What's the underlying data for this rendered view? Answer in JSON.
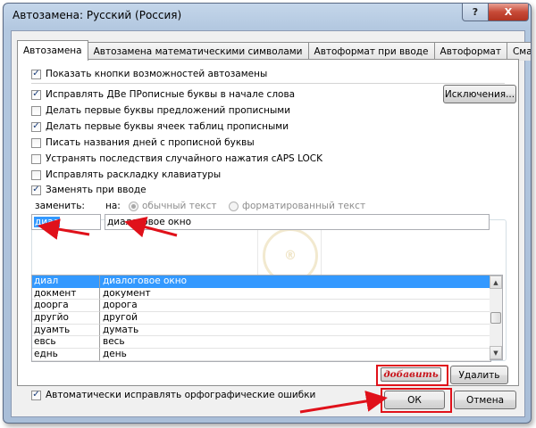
{
  "window": {
    "title": "Автозамена: Русский (Россия)",
    "help_glyph": "?",
    "close_glyph": "X"
  },
  "tabs": [
    {
      "label": "Автозамена",
      "active": true
    },
    {
      "label": "Автозамена математическими символами",
      "active": false
    },
    {
      "label": "Автоформат при вводе",
      "active": false
    },
    {
      "label": "Автоформат",
      "active": false
    },
    {
      "label": "Смарт-теги",
      "active": false
    }
  ],
  "options": {
    "show_buttons": {
      "label": "Показать кнопки возможностей автозамены",
      "checked": true
    },
    "two_caps": {
      "label": "Исправлять ДВе ПРописные буквы в начале слова",
      "checked": true
    },
    "first_sentence": {
      "label": "Делать первые буквы предложений прописными",
      "checked": false
    },
    "first_cell": {
      "label": "Делать первые буквы ячеек таблиц прописными",
      "checked": true
    },
    "day_names": {
      "label": "Писать названия дней с прописной буквы",
      "checked": false
    },
    "caps_lock": {
      "label": "Устранять последствия случайного нажатия cAPS LOCK",
      "checked": false
    },
    "keyboard_layout": {
      "label": "Исправлять раскладку клавиатуры",
      "checked": false
    },
    "replace_as_type": {
      "label": "Заменять при вводе",
      "checked": true
    },
    "auto_spelling": {
      "label": "Автоматически исправлять орфографические ошибки",
      "checked": true
    }
  },
  "buttons": {
    "exceptions": "Исключения...",
    "add": "добавить",
    "delete": "Удалить",
    "ok": "ОК",
    "cancel": "Отмена"
  },
  "replace": {
    "replace_label": "заменить:",
    "with_label": "на:",
    "plain_text": "обычный текст",
    "formatted_text": "форматированный текст",
    "replace_value": "диал",
    "with_value": "диалоговое окно"
  },
  "entries": [
    {
      "from": "диал",
      "to": "диалоговое окно",
      "selected": true
    },
    {
      "from": "докмент",
      "to": "документ",
      "selected": false
    },
    {
      "from": "доорга",
      "to": "дорога",
      "selected": false
    },
    {
      "from": "другйо",
      "to": "другой",
      "selected": false
    },
    {
      "from": "дуамть",
      "to": "думать",
      "selected": false
    },
    {
      "from": "евсь",
      "to": "весь",
      "selected": false
    },
    {
      "from": "еднь",
      "to": "день",
      "selected": false
    }
  ],
  "colors": {
    "selection": "#3399ff",
    "annotation_red": "#e0111a"
  }
}
